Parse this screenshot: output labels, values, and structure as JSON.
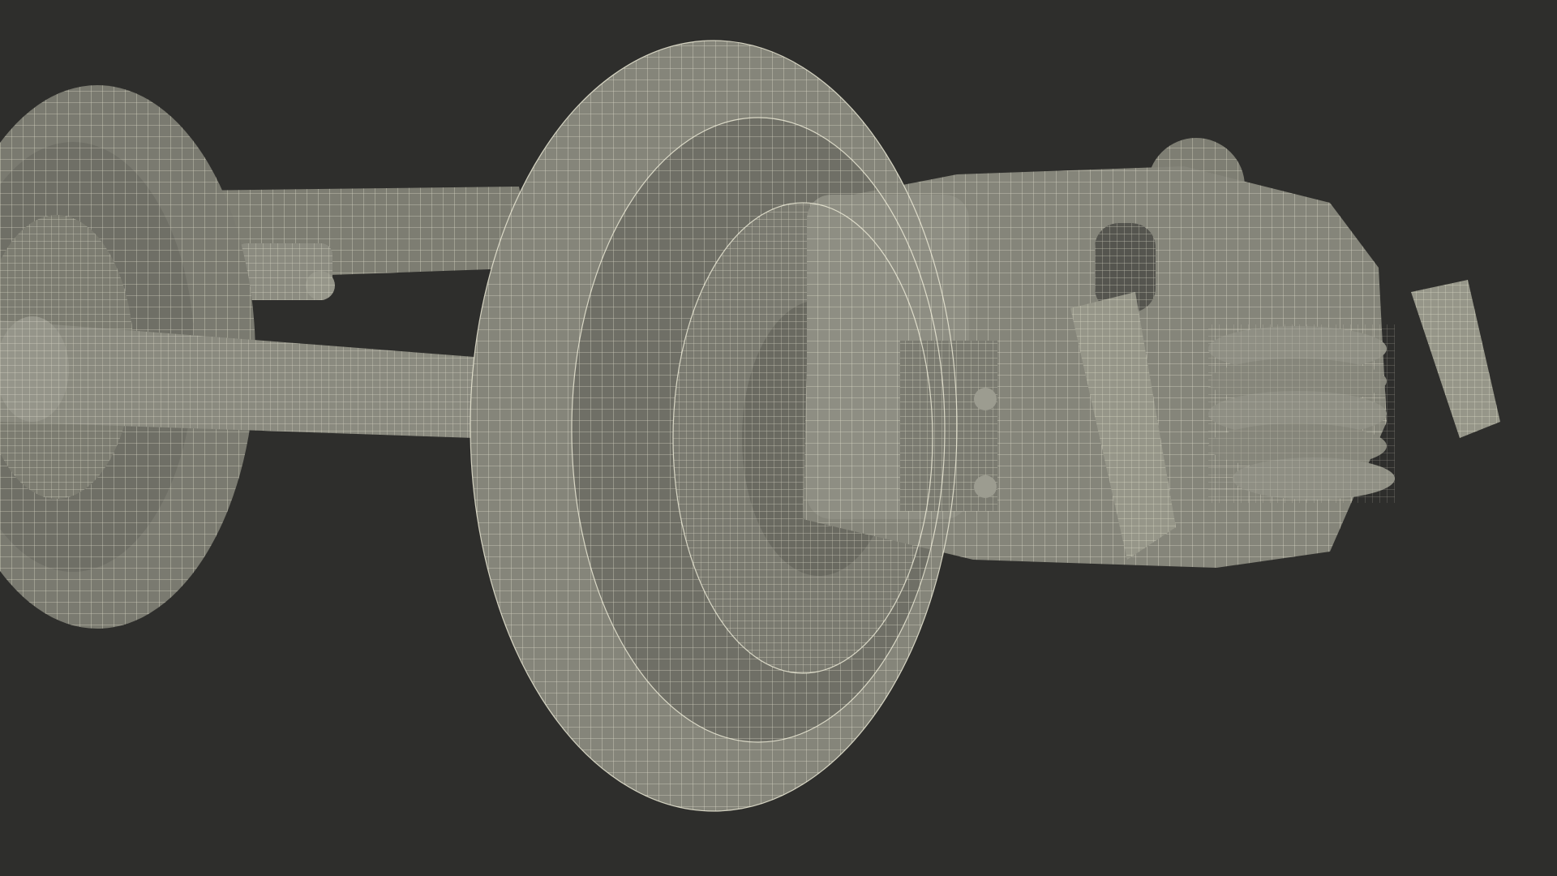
{
  "scene": {
    "subject": "wireframe-render-railway-bogie",
    "colors": {
      "background": "#2e2e2c",
      "surface": "#85857a",
      "surface_dark": "#6f6f66",
      "surface_light": "#999a8d",
      "wire": "#f2f0dc"
    }
  }
}
